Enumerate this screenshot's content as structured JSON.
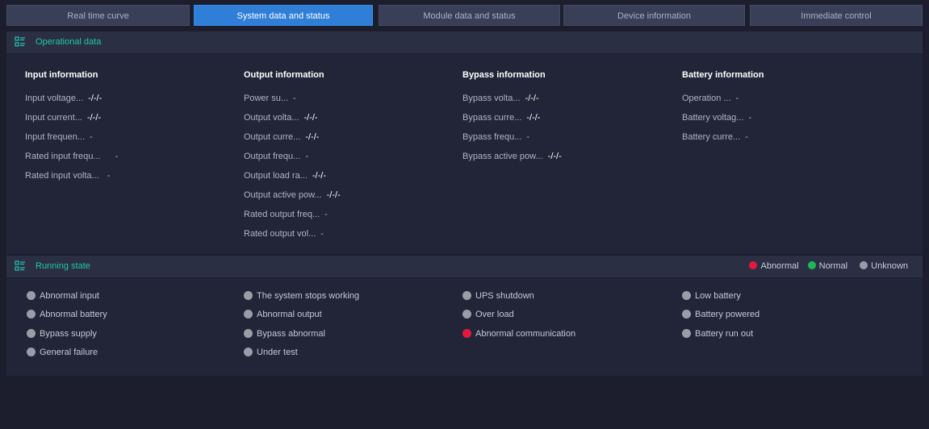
{
  "colors": {
    "accent": "#2f7ed8",
    "section_title": "#20c7b0",
    "abnormal": "#e31a3c",
    "normal": "#1db954",
    "unknown": "#9a9da8"
  },
  "tabs": [
    {
      "label": "Real time curve",
      "active": false
    },
    {
      "label": "System data and status",
      "active": true
    },
    {
      "label": "Module data and status",
      "active": false
    },
    {
      "label": "Device information",
      "active": false
    },
    {
      "label": "Immediate control",
      "active": false
    }
  ],
  "operational": {
    "title": "Operational data",
    "icon": "list-icon",
    "columns": [
      {
        "heading": "Input information",
        "rows": [
          {
            "label": "Input voltage...",
            "value": "-/-/-"
          },
          {
            "label": "Input current...",
            "value": "-/-/-"
          },
          {
            "label": "Input frequen...",
            "value": "-"
          },
          {
            "label": "Rated input frequ...",
            "value": "-"
          },
          {
            "label": "Rated input volta...",
            "value": "-"
          }
        ]
      },
      {
        "heading": "Output information",
        "rows": [
          {
            "label": "Power su...",
            "value": "-"
          },
          {
            "label": "Output volta...",
            "value": "-/-/-"
          },
          {
            "label": "Output curre...",
            "value": "-/-/-"
          },
          {
            "label": "Output frequ...",
            "value": "-"
          },
          {
            "label": "Output load ra...",
            "value": "-/-/-"
          },
          {
            "label": "Output active pow...",
            "value": "-/-/-"
          },
          {
            "label": "Rated output freq...",
            "value": "-"
          },
          {
            "label": "Rated output vol...",
            "value": "-"
          }
        ]
      },
      {
        "heading": "Bypass information",
        "rows": [
          {
            "label": "Bypass volta...",
            "value": "-/-/-"
          },
          {
            "label": "Bypass curre...",
            "value": "-/-/-"
          },
          {
            "label": "Bypass frequ...",
            "value": "-"
          },
          {
            "label": "Bypass active pow...",
            "value": "-/-/-"
          }
        ]
      },
      {
        "heading": "Battery information",
        "rows": [
          {
            "label": "Operation ...",
            "value": "-"
          },
          {
            "label": "Battery voltag...",
            "value": "-"
          },
          {
            "label": "Battery curre...",
            "value": "-"
          }
        ]
      }
    ]
  },
  "running": {
    "title": "Running state",
    "icon": "list-icon",
    "legend": [
      {
        "label": "Abnormal",
        "status": "abnormal"
      },
      {
        "label": "Normal",
        "status": "normal"
      },
      {
        "label": "Unknown",
        "status": "unknown"
      }
    ],
    "columns": [
      [
        {
          "label": "Abnormal input",
          "status": "unknown"
        },
        {
          "label": "Abnormal battery",
          "status": "unknown"
        },
        {
          "label": "Bypass supply",
          "status": "unknown"
        },
        {
          "label": "General failure",
          "status": "unknown"
        }
      ],
      [
        {
          "label": "The system stops working",
          "status": "unknown"
        },
        {
          "label": "Abnormal output",
          "status": "unknown"
        },
        {
          "label": "Bypass abnormal",
          "status": "unknown"
        },
        {
          "label": "Under test",
          "status": "unknown"
        }
      ],
      [
        {
          "label": "UPS shutdown",
          "status": "unknown"
        },
        {
          "label": "Over load",
          "status": "unknown"
        },
        {
          "label": "Abnormal communication",
          "status": "abnormal"
        }
      ],
      [
        {
          "label": "Low battery",
          "status": "unknown"
        },
        {
          "label": "Battery powered",
          "status": "unknown"
        },
        {
          "label": "Battery run out",
          "status": "unknown"
        }
      ]
    ]
  }
}
